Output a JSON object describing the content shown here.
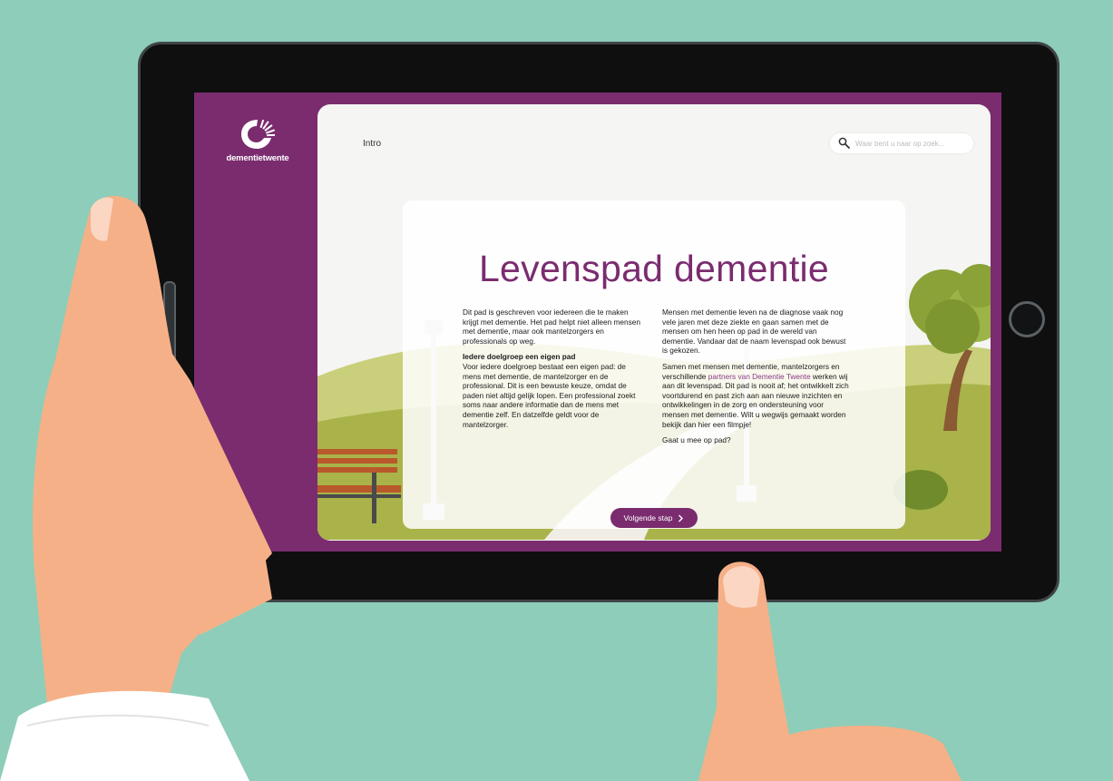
{
  "brand": {
    "logo_text": "dementietwente",
    "accent": "#7a2c6f",
    "background": "#8ecdb9"
  },
  "nav": {
    "intro_label": "Intro"
  },
  "search": {
    "placeholder": "Waar bent u naar op zoek...",
    "icon": "search-icon"
  },
  "hero": {
    "title": "Levenspad dementie"
  },
  "left_column": {
    "intro": "Dit pad is geschreven voor iedereen die te maken krijgt met dementie. Het pad helpt niet alleen mensen met dementie, maar ook mantelzorgers en professionals op weg.",
    "heading": "Iedere doelgroep een eigen pad",
    "body": "Voor iedere doelgroep bestaat een eigen pad: de mens met dementie, de mantelzorger en de professional. Dit is een bewuste keuze, omdat de paden niet altijd gelijk lopen. Een professional zoekt soms naar andere informatie dan de mens met dementie zelf. En datzelfde geldt voor de mantelzorger."
  },
  "right_column": {
    "p1": "Mensen met dementie leven na de diagnose vaak nog vele jaren met deze ziekte en gaan samen met de mensen om hen heen op pad in de wereld van dementie. Vandaar dat de naam levenspad ook bewust is gekozen.",
    "p2_before": "Samen met mensen met dementie, mantelzorgers en verschillende ",
    "p2_link": "partners van Dementie Twente",
    "p2_after": " werken wij aan dit levenspad. Dit pad is nooit af; het ontwikkelt zich voortdurend en past zich aan aan nieuwe inzichten en ontwikkelingen in de zorg en ondersteuning voor mensen met dementie. Wilt u wegwijs gemaakt worden bekijk dan hier een filmpje!",
    "p3": "Gaat u mee op pad?"
  },
  "cta": {
    "next_label": "Volgende stap",
    "next_icon": "chevron-right-icon"
  }
}
